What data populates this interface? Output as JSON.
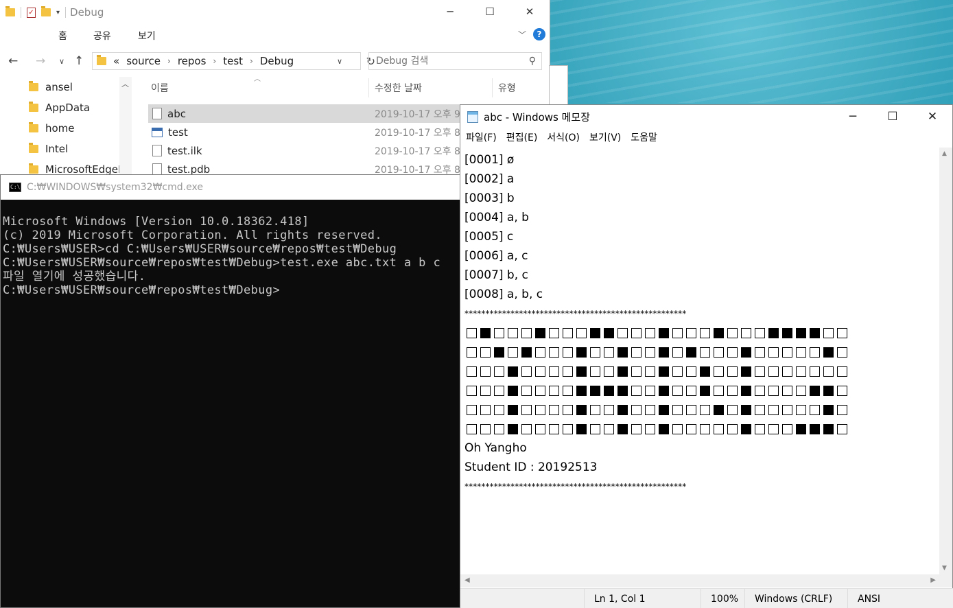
{
  "explorer": {
    "title": "Debug",
    "ribbon_tabs": [
      "홈",
      "공유",
      "보기"
    ],
    "breadcrumb": [
      "«",
      "source",
      "repos",
      "test",
      "Debug"
    ],
    "search_placeholder": "Debug 검색",
    "nav_items": [
      "ansel",
      "AppData",
      "home",
      "Intel",
      "MicrosoftEdgeB"
    ],
    "columns": {
      "name": "이름",
      "modified": "수정한 날짜",
      "type": "유형"
    },
    "files": [
      {
        "name": "abc",
        "date": "2019-10-17 오후 9"
      },
      {
        "name": "test",
        "date": "2019-10-17 오후 8"
      },
      {
        "name": "test.ilk",
        "date": "2019-10-17 오후 8"
      },
      {
        "name": "test.pdb",
        "date": "2019-10-17 오후 8"
      }
    ]
  },
  "cmd": {
    "title": "C:₩WINDOWS₩system32₩cmd.exe",
    "lines": [
      "Microsoft Windows [Version 10.0.18362.418]",
      "(c) 2019 Microsoft Corporation. All rights reserved.",
      "",
      "C:₩Users₩USER>cd C:₩Users₩USER₩source₩repos₩test₩Debug",
      "",
      "C:₩Users₩USER₩source₩repos₩test₩Debug>test.exe abc.txt a b c",
      "파일 열기에 성공했습니다.",
      "",
      "C:₩Users₩USER₩source₩repos₩test₩Debug>"
    ]
  },
  "notepad": {
    "title": "abc - Windows 메모장",
    "menu": [
      "파일(F)",
      "편집(E)",
      "서식(O)",
      "보기(V)",
      "도움말"
    ],
    "subsets": [
      "[0001] ø",
      "[0002] a",
      "[0003] b",
      "[0004] a, b",
      "[0005] c",
      "[0006] a, c",
      "[0007] b, c",
      "[0008] a, b, c"
    ],
    "stars": "*****************************************************",
    "grid": [
      "0100010001100010001000111100",
      "0010100010010010100010000010",
      "0001000010010010010010000000",
      "0001000011110010010010000110",
      "0001000010010010001010000010",
      "0001000010010010000010001110"
    ],
    "name": "Oh Yangho",
    "student_id": "Student ID : 20192513",
    "status": {
      "position": "Ln 1, Col 1",
      "zoom": "100%",
      "line_ending": "Windows (CRLF)",
      "encoding": "ANSI"
    }
  }
}
